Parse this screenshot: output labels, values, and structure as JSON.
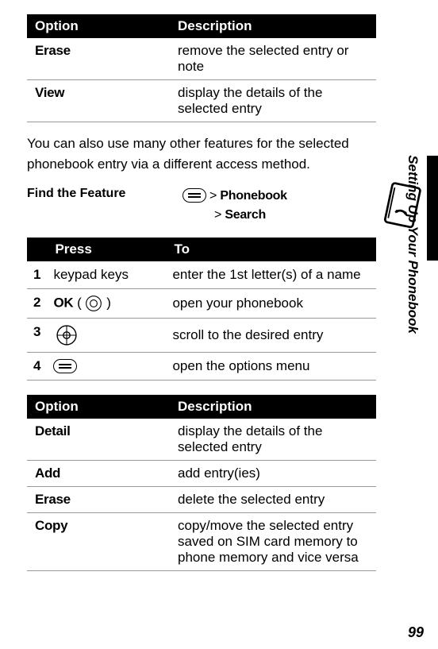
{
  "table1": {
    "headers": {
      "option": "Option",
      "description": "Description"
    },
    "rows": [
      {
        "option": "Erase",
        "description": "remove the selected entry or note"
      },
      {
        "option": "View",
        "description": "display the details of the selected entry"
      }
    ]
  },
  "paragraph": "You can also use many other features for the selected phonebook entry via a different access method.",
  "feature": {
    "label": "Find the Feature",
    "gt": ">",
    "path1": "Phonebook",
    "path2": "Search"
  },
  "pressTable": {
    "headers": {
      "press": "Press",
      "to": "To"
    },
    "rows": [
      {
        "num": "1",
        "press": "keypad keys",
        "to": "enter the 1st letter(s) of a name"
      },
      {
        "num": "2",
        "press_prefix": "OK",
        "press_paren_open": " ( ",
        "press_paren_close": " )",
        "to": "open your phonebook"
      },
      {
        "num": "3",
        "to": "scroll to the desired entry"
      },
      {
        "num": "4",
        "to": "open the options menu"
      }
    ]
  },
  "table3": {
    "headers": {
      "option": "Option",
      "description": "Description"
    },
    "rows": [
      {
        "option": "Detail",
        "description": "display the details of the selected entry"
      },
      {
        "option": "Add",
        "description": "add entry(ies)"
      },
      {
        "option": "Erase",
        "description": "delete the selected entry"
      },
      {
        "option": "Copy",
        "description": "copy/move the selected entry saved on SIM card memory to phone memory and vice versa"
      }
    ]
  },
  "side": {
    "text": "Setting Up Your Phonebook"
  },
  "pageNumber": "99"
}
